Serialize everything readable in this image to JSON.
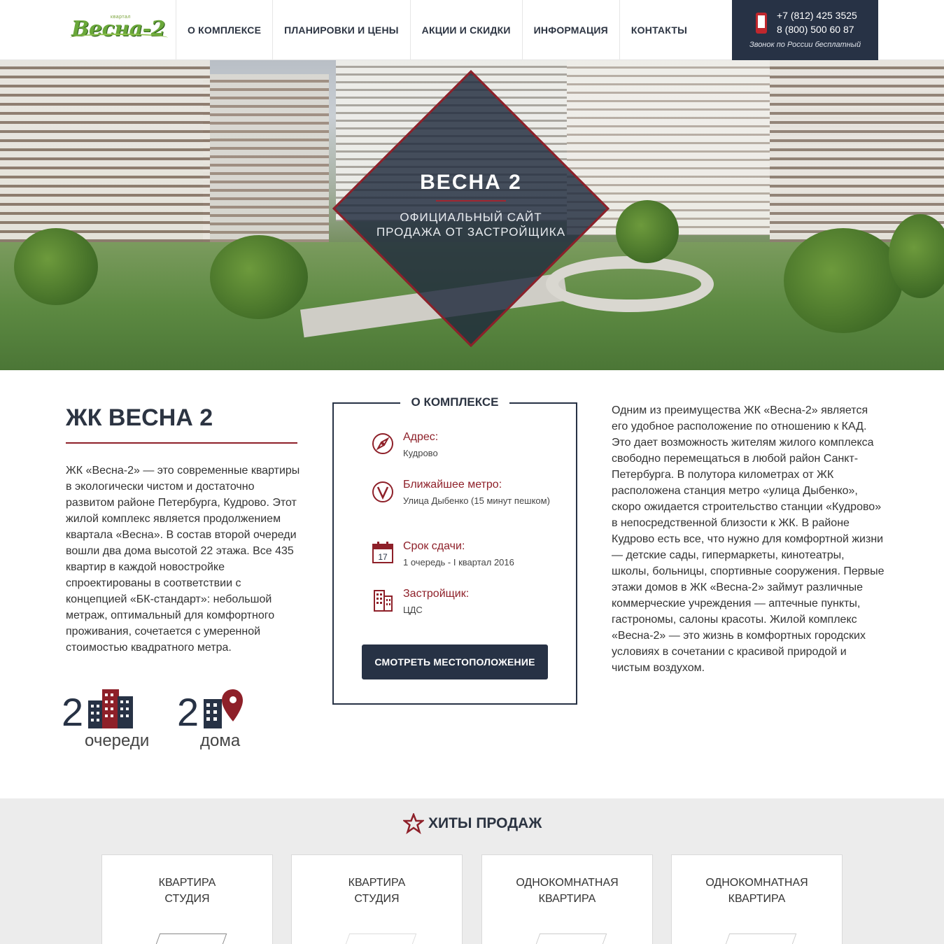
{
  "header": {
    "logo_small": "квартал",
    "logo_text": "Весна-2",
    "nav": [
      "О комплексе",
      "Планировки и цены",
      "Акции и скидки",
      "Информация",
      "Контакты"
    ],
    "phone1": "+7 (812) 425 3525",
    "phone2": "8 (800) 500 60 87",
    "phone_note": "Звонок по России бесплатный"
  },
  "hero": {
    "title": "ВЕСНА 2",
    "subtitle_line1": "ОФИЦИАЛЬНЫЙ САЙТ",
    "subtitle_line2": "ПРОДАЖА ОТ ЗАСТРОЙЩИКА"
  },
  "about": {
    "title": "ЖК ВЕСНА 2",
    "text": "ЖК «Весна-2» — это современные квартиры в экологически чистом и достаточно развитом районе Петербурга, Кудрово. Этот жилой комплекс является продолжением квартала «Весна». В состав второй очереди вошли два дома высотой 22 этажа. Все 435 квартир в каждой новостройке спроектированы в соответствии с концепцией «БК-стандарт»: небольшой метраж, оптимальный для комфортного проживания, сочетается с умеренной стоимостью квадратного метра.",
    "stats": [
      {
        "num": "2",
        "label": "очереди",
        "icon": "buildings-icon"
      },
      {
        "num": "2",
        "label": "дома",
        "icon": "building-pin-icon"
      }
    ]
  },
  "info": {
    "title": "О КОМПЛЕКСЕ",
    "items": [
      {
        "label": "Адрес:",
        "value": "Кудрово",
        "icon": "compass-icon"
      },
      {
        "label": "Ближайшее метро:",
        "value": "Улица Дыбенко (15 минут пешком)",
        "icon": "metro-icon"
      },
      {
        "label": "Срок сдачи:",
        "value": "1 очередь - I квартал 2016",
        "icon": "calendar-icon",
        "calendar_day": "17"
      },
      {
        "label": "Застройщик:",
        "value": "ЦДС",
        "icon": "developer-building-icon"
      }
    ],
    "button": "Смотреть местоположение"
  },
  "right_text": "Одним из преимущества ЖК «Весна-2» является его удобное расположение по отношению к КАД. Это дает возможность жителям жилого комплекса свободно перемещаться в любой район Санкт-Петербурга. В полутора километрах от ЖК расположена станция метро «улица Дыбенко», скоро ожидается строительство станции «Кудрово» в непосредственной близости к ЖК. В районе Кудрово есть все, что нужно для комфортной жизни — детские сады, гипермаркеты, кинотеатры, школы, больницы, спортивные сооружения. Первые этажи домов в ЖК «Весна-2» займут различные коммерческие учреждения — аптечные пункты, гастрономы, салоны красоты. Жилой комплекс «Весна-2» — это жизнь в комфортных городских условиях в сочетании с красивой природой и чистым воздухом.",
  "hits": {
    "title": "ХИТЫ ПРОДАЖ",
    "cards": [
      {
        "line1": "Квартира",
        "line2": "студия"
      },
      {
        "line1": "Квартира",
        "line2": "студия"
      },
      {
        "line1": "Однокомнатная",
        "line2": "квартира"
      },
      {
        "line1": "Однокомнатная",
        "line2": "квартира"
      }
    ]
  },
  "colors": {
    "navy": "#273245",
    "accent_red": "#8e2029",
    "logo_green": "#6aa83a",
    "hits_bg": "#ececec"
  }
}
